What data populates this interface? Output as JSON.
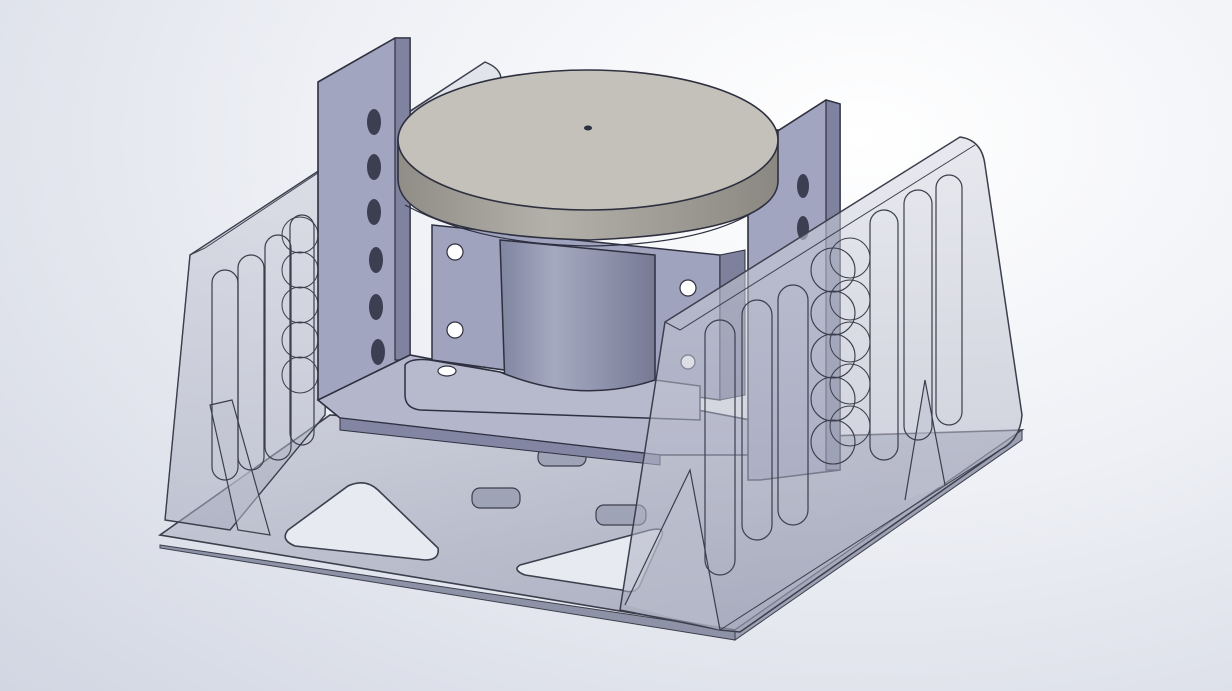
{
  "viewport": {
    "background_top": "#ffffff",
    "background_bottom": "#d2d6e2"
  },
  "model": {
    "parts": [
      {
        "name": "base-plate",
        "color": "#aeb1c2",
        "transparent": true
      },
      {
        "name": "left-side-wall",
        "color": "#c3c6d4",
        "transparent": true
      },
      {
        "name": "right-side-wall",
        "color": "#c3c6d4",
        "transparent": true
      },
      {
        "name": "l-bracket",
        "color": "#9497b4"
      },
      {
        "name": "servo-motor",
        "color": "#8d91ab"
      },
      {
        "name": "round-disc",
        "color": "#c2c0b7"
      }
    ]
  }
}
